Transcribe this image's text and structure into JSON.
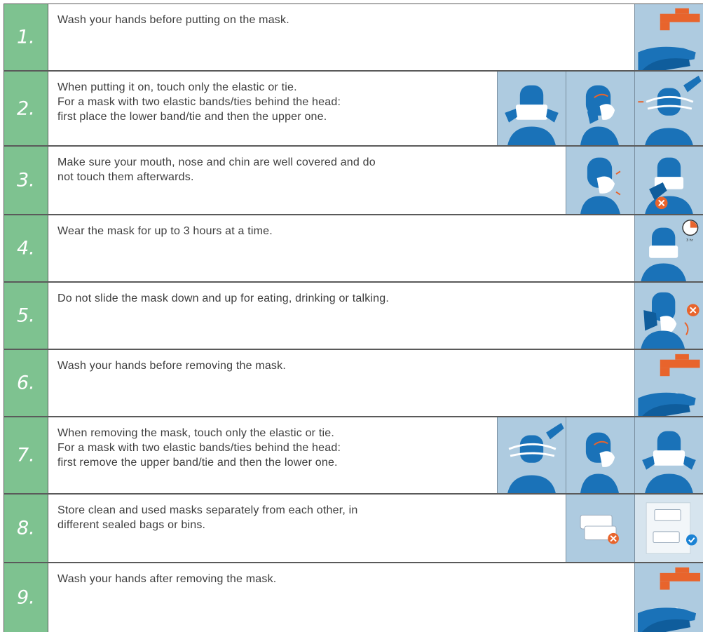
{
  "steps": [
    {
      "number": "1.",
      "lines": [
        "Wash your hands before putting on the mask."
      ],
      "icons": [
        "hand-washing-icon"
      ]
    },
    {
      "number": "2.",
      "lines": [
        "When putting it on, touch only the elastic or tie.",
        "For a mask with two elastic bands/ties behind the head:",
        "first place the lower band/tie and then the upper one."
      ],
      "icons": [
        "mask-front-icon",
        "mask-side-icon",
        "mask-ties-icon"
      ]
    },
    {
      "number": "3.",
      "lines": [
        "Make sure your mouth, nose and chin are well covered and do",
        "not touch them afterwards."
      ],
      "icons": [
        "mask-cover-icon",
        "no-touch-mask-icon"
      ]
    },
    {
      "number": "4.",
      "lines": [
        "Wear the mask for up to 3 hours at a time."
      ],
      "icons": [
        "mask-timer-icon"
      ]
    },
    {
      "number": "5.",
      "lines": [
        "Do not slide the mask down and up for eating, drinking or talking."
      ],
      "icons": [
        "no-slide-mask-icon"
      ]
    },
    {
      "number": "6.",
      "lines": [
        "Wash your hands before removing the mask."
      ],
      "icons": [
        "hand-washing-icon"
      ]
    },
    {
      "number": "7.",
      "lines": [
        "When removing the mask, touch only the elastic or tie.",
        "For a mask with two elastic bands/ties behind the head:",
        "first remove the upper band/tie and then the lower one."
      ],
      "icons": [
        "mask-ties-icon",
        "mask-side-icon",
        "mask-front-icon"
      ]
    },
    {
      "number": "8.",
      "lines": [
        "Store clean and used masks separately from each other, in",
        "different sealed bags or bins."
      ],
      "icons": [
        "used-masks-icon",
        "clean-masks-icon"
      ]
    },
    {
      "number": "9.",
      "lines": [
        "Wash your hands after removing the mask."
      ],
      "icons": [
        "hand-washing-icon"
      ]
    }
  ],
  "timer_label": "3 hr",
  "colors": {
    "number_cell": "#7ec290",
    "icon_background": "#aecbe0",
    "icon_blue": "#1a72b8",
    "accent_orange": "#e8642c",
    "text": "#3d3d3d"
  }
}
